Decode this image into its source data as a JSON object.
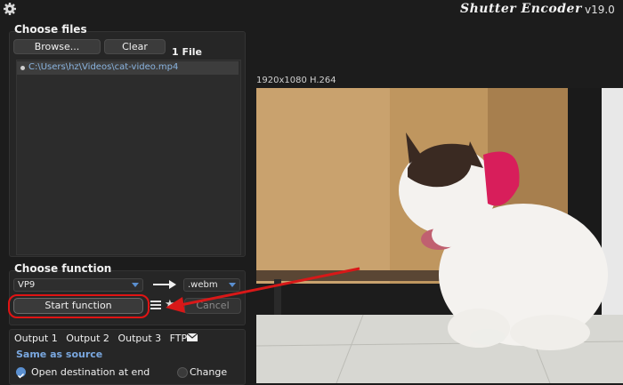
{
  "app": {
    "title": "Shutter Encoder",
    "version": "v19.0"
  },
  "files": {
    "section_title": "Choose files",
    "browse_label": "Browse...",
    "clear_label": "Clear",
    "count_label": "1 File",
    "items": [
      "C:\\Users\\hz\\Videos\\cat-video.mp4"
    ]
  },
  "function": {
    "section_title": "Choose function",
    "selected": "VP9",
    "extension": ".webm",
    "start_label": "Start function",
    "cancel_label": "Cancel"
  },
  "output": {
    "tabs": [
      "Output 1",
      "Output 2",
      "Output 3",
      "FTP"
    ],
    "destination": "Same as source",
    "open_dest_label": "Open destination at end",
    "change_label": "Change"
  },
  "preview": {
    "info": "1920x1080 H.264"
  },
  "colors": {
    "accent": "#5a8fd0",
    "highlight": "#e01414"
  }
}
